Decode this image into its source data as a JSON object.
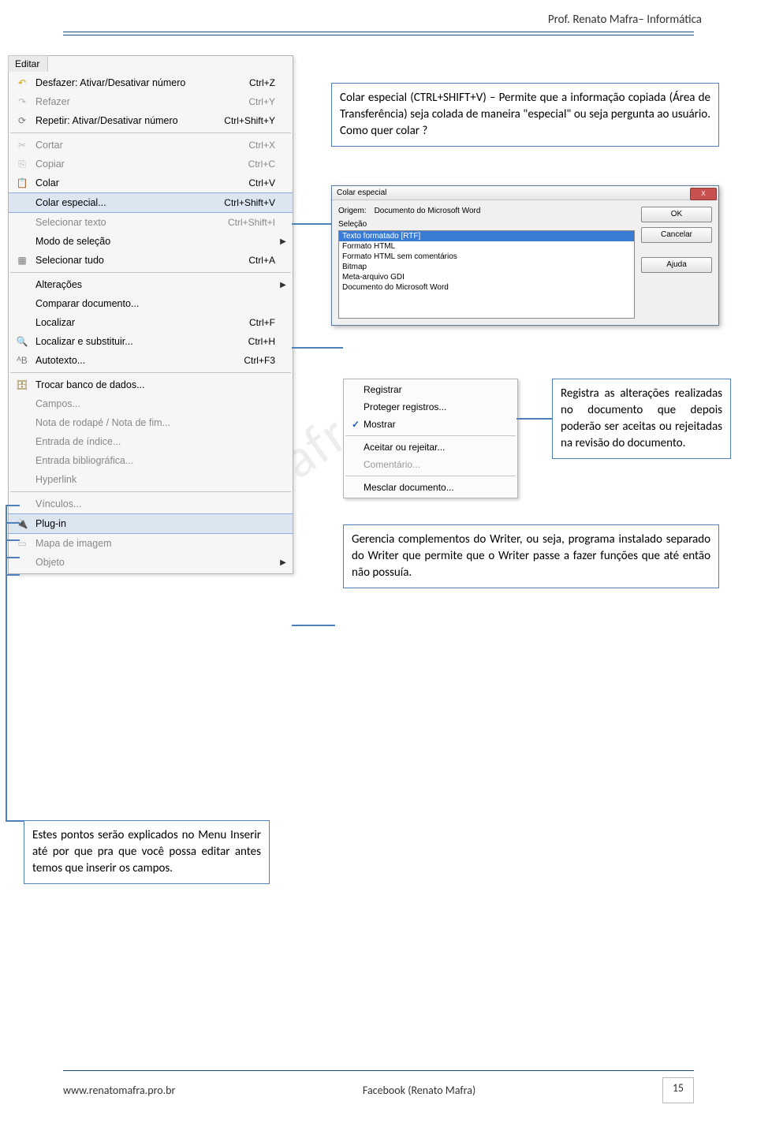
{
  "header": "Prof. Renato Mafra– Informática",
  "menu_title": "Editar",
  "menu": [
    {
      "icon": "↶",
      "iconcls": "ic-yellow",
      "label": "Desfazer: Ativar/Desativar número",
      "shortcut": "Ctrl+Z"
    },
    {
      "icon": "↷",
      "iconcls": "ic-dim",
      "label": "Refazer",
      "shortcut": "Ctrl+Y",
      "dim": true
    },
    {
      "icon": "⟳",
      "iconcls": "ic-gray",
      "label": "Repetir: Ativar/Desativar número",
      "shortcut": "Ctrl+Shift+Y"
    },
    {
      "sep": true
    },
    {
      "icon": "✂",
      "iconcls": "ic-dim",
      "label": "Cortar",
      "shortcut": "Ctrl+X",
      "dim": true
    },
    {
      "icon": "⎘",
      "iconcls": "ic-dim",
      "label": "Copiar",
      "shortcut": "Ctrl+C",
      "dim": true
    },
    {
      "icon": "📋",
      "iconcls": "ic-clip",
      "label": "Colar",
      "shortcut": "Ctrl+V"
    },
    {
      "icon": "",
      "label": "Colar especial...",
      "shortcut": "Ctrl+Shift+V",
      "hl": true
    },
    {
      "icon": "",
      "label": "Selecionar texto",
      "shortcut": "Ctrl+Shift+I",
      "dim": true
    },
    {
      "icon": "",
      "label": "Modo de seleção",
      "sub": true
    },
    {
      "icon": "▦",
      "iconcls": "ic-gray",
      "label": "Selecionar tudo",
      "shortcut": "Ctrl+A"
    },
    {
      "sep": true
    },
    {
      "icon": "",
      "label": "Alterações",
      "sub": true
    },
    {
      "icon": "",
      "label": "Comparar documento..."
    },
    {
      "icon": "",
      "label": "Localizar",
      "shortcut": "Ctrl+F"
    },
    {
      "icon": "🔍",
      "iconcls": "ic-yellow",
      "label": "Localizar e substituir...",
      "shortcut": "Ctrl+H"
    },
    {
      "icon": "ᴬB",
      "iconcls": "ic-gray",
      "label": "Autotexto...",
      "shortcut": "Ctrl+F3"
    },
    {
      "sep": true
    },
    {
      "icon": "🗄",
      "iconcls": "ic-db",
      "label": "Trocar banco de dados..."
    },
    {
      "icon": "",
      "label": "Campos...",
      "dim": true
    },
    {
      "icon": "",
      "label": "Nota de rodapé / Nota de fim...",
      "dim": true
    },
    {
      "icon": "",
      "label": "Entrada de índice...",
      "dim": true
    },
    {
      "icon": "",
      "label": "Entrada bibliográfica...",
      "dim": true
    },
    {
      "icon": "",
      "label": "Hyperlink",
      "dim": true
    },
    {
      "sep": true
    },
    {
      "icon": "",
      "label": "Vínculos...",
      "dim": true
    },
    {
      "icon": "🔌",
      "iconcls": "ic-plug",
      "label": "Plug-in",
      "hl": true
    },
    {
      "icon": "▭",
      "iconcls": "ic-dim",
      "label": "Mapa de imagem",
      "dim": true
    },
    {
      "icon": "",
      "label": "Objeto",
      "dim": true,
      "sub": true
    }
  ],
  "callouts": {
    "c1": "Colar especial (CTRL+SHIFT+V) – Permite que a informação copiada (Área de Transferência) seja colada de maneira \"especial\" ou seja pergunta ao usuário. Como quer colar ?",
    "c2": "Registra as alterações realizadas no documento que depois poderão ser aceitas ou rejeitadas na revisão do documento.",
    "c3": "Gerencia complementos do Writer, ou seja, programa instalado separado do Writer que permite que o Writer passe a fazer funções que até então não possuía.",
    "c4": "Estes pontos serão explicados no Menu Inserir até por que pra que você possa editar antes temos que inserir os campos."
  },
  "dialog": {
    "title": "Colar especial",
    "origin_lbl": "Origem:",
    "origin_val": "Documento do Microsoft Word",
    "selection_lbl": "Seleção",
    "options": [
      "Texto formatado [RTF]",
      "Formato HTML",
      "Formato HTML sem comentários",
      "Bitmap",
      "Meta-arquivo GDI",
      "Documento do Microsoft Word"
    ],
    "btn_ok": "OK",
    "btn_cancel": "Cancelar",
    "btn_help": "Ajuda"
  },
  "submenu": [
    {
      "label": "Registrar"
    },
    {
      "label": "Proteger registros..."
    },
    {
      "label": "Mostrar",
      "check": true
    },
    {
      "sep": true
    },
    {
      "label": "Aceitar ou rejeitar..."
    },
    {
      "label": "Comentário...",
      "dim": true
    },
    {
      "sep": true
    },
    {
      "label": "Mesclar documento..."
    }
  ],
  "footer": {
    "left": "www.renatomafra.pro.br",
    "center": "Facebook (Renato Mafra)",
    "page": "15"
  }
}
